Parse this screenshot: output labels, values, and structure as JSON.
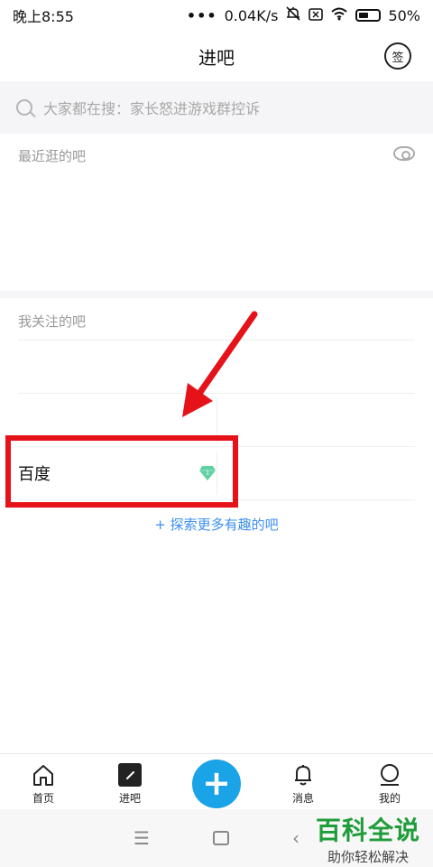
{
  "status_bar": {
    "time": "晚上8:55",
    "dots": "•••",
    "speed": "0.04K/s",
    "battery": "50%"
  },
  "header": {
    "title": "进吧",
    "sign_label": "签"
  },
  "search": {
    "placeholder": "大家都在搜：家长怒进游戏群控诉"
  },
  "recent": {
    "label": "最近逛的吧"
  },
  "followed": {
    "label": "我关注的吧",
    "items": [
      {
        "name": "百度",
        "level": "1"
      }
    ],
    "explore_link": "+ 探索更多有趣的吧"
  },
  "bottom_nav": {
    "items": [
      {
        "label": "首页"
      },
      {
        "label": "进吧"
      },
      {
        "label": ""
      },
      {
        "label": "消息"
      },
      {
        "label": "我的"
      }
    ],
    "post_symbol": "+"
  },
  "system_nav": {
    "menu": "☰",
    "back": "‹"
  },
  "watermark": {
    "title": "百科全说",
    "subtitle": "助你轻松解决"
  },
  "colors": {
    "accent": "#1aa3e6",
    "link": "#3a8ef0",
    "highlight": "#e5121a",
    "gem": "#5fd1a4",
    "watermark": "#1f9d3a"
  }
}
